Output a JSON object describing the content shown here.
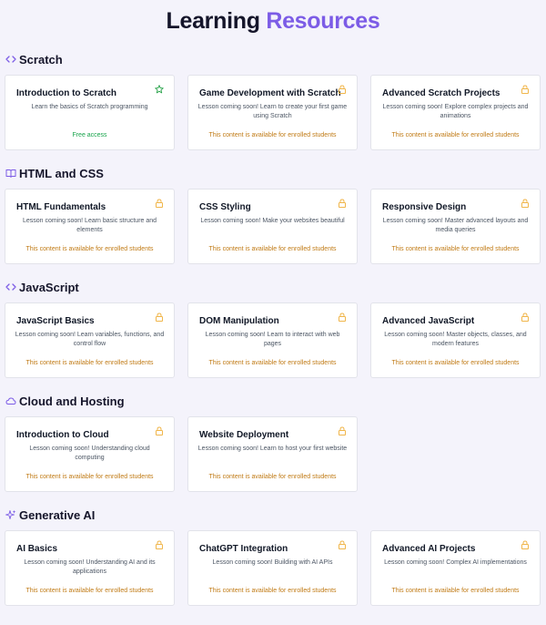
{
  "header": {
    "title_part1": "Learning",
    "title_part2": "Resources"
  },
  "colors": {
    "accent": "#7c5ce6",
    "locked": "#c07a14",
    "free": "#16a34a",
    "lock_icon": "#f0b64b",
    "star_icon": "#22a045"
  },
  "sections": [
    {
      "title": "Scratch",
      "icon": "code-icon",
      "cards": [
        {
          "title": "Introduction to Scratch",
          "desc": "Learn the basics of Scratch programming",
          "footer": "Free access",
          "icon": "star-icon"
        },
        {
          "title": "Game Development with Scratch",
          "desc": "Lesson coming soon! Learn to create your first game using Scratch",
          "footer": "This content is available for enrolled students",
          "icon": "lock-icon"
        },
        {
          "title": "Advanced Scratch Projects",
          "desc": "Lesson coming soon! Explore complex projects and animations",
          "footer": "This content is available for enrolled students",
          "icon": "lock-icon"
        }
      ]
    },
    {
      "title": "HTML and CSS",
      "icon": "book-icon",
      "cards": [
        {
          "title": "HTML Fundamentals",
          "desc": "Lesson coming soon! Learn basic structure and elements",
          "footer": "This content is available for enrolled students",
          "icon": "lock-icon"
        },
        {
          "title": "CSS Styling",
          "desc": "Lesson coming soon! Make your websites beautiful",
          "footer": "This content is available for enrolled students",
          "icon": "lock-icon"
        },
        {
          "title": "Responsive Design",
          "desc": "Lesson coming soon! Master advanced layouts and media queries",
          "footer": "This content is available for enrolled students",
          "icon": "lock-icon"
        }
      ]
    },
    {
      "title": "JavaScript",
      "icon": "code-icon",
      "cards": [
        {
          "title": "JavaScript Basics",
          "desc": "Lesson coming soon! Learn variables, functions, and control flow",
          "footer": "This content is available for enrolled students",
          "icon": "lock-icon"
        },
        {
          "title": "DOM Manipulation",
          "desc": "Lesson coming soon! Learn to interact with web pages",
          "footer": "This content is available for enrolled students",
          "icon": "lock-icon"
        },
        {
          "title": "Advanced JavaScript",
          "desc": "Lesson coming soon! Master objects, classes, and modern features",
          "footer": "This content is available for enrolled students",
          "icon": "lock-icon"
        }
      ]
    },
    {
      "title": "Cloud and Hosting",
      "icon": "cloud-icon",
      "cards": [
        {
          "title": "Introduction to Cloud",
          "desc": "Lesson coming soon! Understanding cloud computing",
          "footer": "This content is available for enrolled students",
          "icon": "lock-icon"
        },
        {
          "title": "Website Deployment",
          "desc": "Lesson coming soon! Learn to host your first website",
          "footer": "This content is available for enrolled students",
          "icon": "lock-icon"
        }
      ]
    },
    {
      "title": "Generative AI",
      "icon": "sparkles-icon",
      "cards": [
        {
          "title": "AI Basics",
          "desc": "Lesson coming soon! Understanding AI and its applications",
          "footer": "This content is available for enrolled students",
          "icon": "lock-icon"
        },
        {
          "title": "ChatGPT Integration",
          "desc": "Lesson coming soon! Building with AI APIs",
          "footer": "This content is available for enrolled students",
          "icon": "lock-icon"
        },
        {
          "title": "Advanced AI Projects",
          "desc": "Lesson coming soon! Complex AI implementations",
          "footer": "This content is available for enrolled students",
          "icon": "lock-icon"
        }
      ]
    }
  ]
}
